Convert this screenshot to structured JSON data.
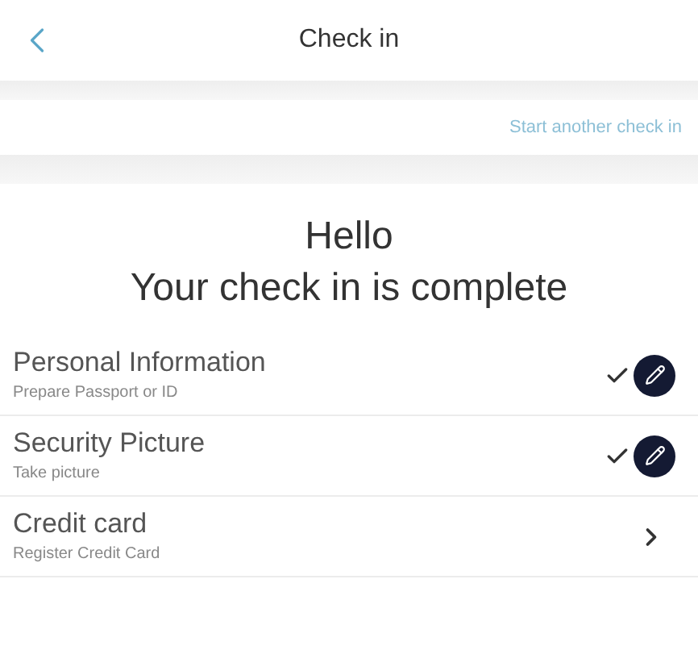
{
  "header": {
    "title": "Check in"
  },
  "link": "Start another check in",
  "greeting": "Hello",
  "message": "Your check in is complete",
  "steps": [
    {
      "title": "Personal Information",
      "subtitle": "Prepare Passport or ID",
      "completed": true
    },
    {
      "title": "Security Picture",
      "subtitle": "Take picture",
      "completed": true
    },
    {
      "title": "Credit card",
      "subtitle": "Register Credit Card",
      "completed": false
    }
  ]
}
